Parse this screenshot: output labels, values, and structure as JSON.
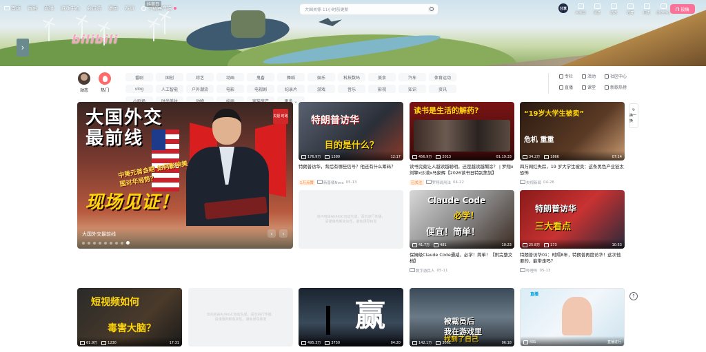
{
  "topnav": {
    "items": [
      "首页",
      "番剧",
      "直播",
      "游戏中心",
      "会员购",
      "漫画",
      "赛事"
    ],
    "bubble": "抖音日",
    "download": "下载客户端"
  },
  "logo": "bilibili",
  "search": {
    "placeholder": "大国关係 11小时前更新"
  },
  "user": {
    "avatar_text": "分享"
  },
  "rightnav": [
    "大会员",
    "消息",
    "动态",
    "收藏",
    "历史",
    "创作中心"
  ],
  "upload": "投稿",
  "channels": {
    "dynamic": "动态",
    "hot": "热门",
    "chips": [
      "番剧",
      "国创",
      "综艺",
      "动画",
      "鬼畜",
      "舞蹈",
      "娱乐",
      "科技数码",
      "美食",
      "汽车",
      "体育运动",
      "vlog",
      "人工智能",
      "户外潮流",
      "电影",
      "电视剧",
      "纪录片",
      "游戏",
      "音乐",
      "影视",
      "知识",
      "资讯",
      "小剧场",
      "时尚美妆",
      "动物",
      "绘画",
      "家装房产",
      "更多 ⌄"
    ],
    "extras": [
      "专栏",
      "活动",
      "社区中心",
      "直播",
      "课堂",
      "新歌热榜"
    ]
  },
  "featured": {
    "title_line1": "大国外交",
    "title_line2": "最前线",
    "subtitle": "中美元首会晤 如何影响美国对华局势？",
    "slogan": "现场见证！",
    "badge": "央视 时政",
    "caption": "大国外交最前线"
  },
  "side_buttons": {
    "refresh": "换一换"
  },
  "cards": [
    {
      "thumb_text": "特朗普访华",
      "thumb_text2": "目的是什么？",
      "views": "176.9万",
      "danmaku": "1380",
      "duration": "12:17",
      "title": "特朗普访华，背后有哪些信号？他还有什么筹码？",
      "tag": "1万点赞",
      "owner": "新晋楠Nora",
      "date": "05-13"
    },
    {
      "thumb_text": "读书是生活的解药?",
      "views": "456.9万",
      "danmaku": "2013",
      "duration": "01:19:33",
      "title": "读书究竟让人越读越聪明，还是越读越糊涂？ | 罗翔x刘擎x沙漠x马家辉【2026读书日特别策划】",
      "tag": "已关注",
      "owner": "罗翔说刑法",
      "date": "04-22"
    },
    {
      "thumb_text": "“19岁大学生被卖”",
      "thumb_text2": "危机 重重",
      "views": "34.2万",
      "danmaku": "1866",
      "duration": "07:14",
      "title": "四万网红失踪，19 岁大学生被卖：这条黑色产业链太恐怖",
      "owner": "央视新闻",
      "date": "04-26"
    },
    {
      "placeholder": "该内容由AI/AIGC自动生成，请勿进行传播，请谨慎判断真实性，避免误导转发"
    },
    {
      "thumb_text": "Claude Code",
      "thumb_text2": "必学！",
      "thumb_text3": "便宜！简单！",
      "views": "41.7万",
      "danmaku": "481",
      "duration": "10:23",
      "title": "保姆级Claude Code通咸，必学！简单！【附完整文档】",
      "owner": "数字游民人",
      "date": "05-11"
    },
    {
      "thumb_text": "特朗普访华",
      "thumb_text2": "三大看点",
      "views": "25.8万",
      "danmaku": "173",
      "duration": "10:53",
      "title": "特朗普访华01：时隔8年，特朗普再度访华！这次他要的，能带走吗？",
      "owner": "哔哩哔",
      "date": "05-13"
    },
    {
      "thumb_text": "短视频如何",
      "thumb_text2": "毒害大脑？",
      "views": "61.9万",
      "danmaku": "1230",
      "duration": "17:31",
      "title": "",
      "owner": "",
      "date": ""
    },
    {
      "placeholder": "该内容由AI/AIGC自动生成，请勿进行传播，请谨慎判断真实性，避免误导转发"
    },
    {
      "thumb_text": "赢",
      "views": "495.3万",
      "danmaku": "3750",
      "duration": "04:20",
      "title": "",
      "owner": "",
      "date": ""
    },
    {
      "thumb_text": "被裁员后",
      "thumb_text2": "我在游戏里",
      "thumb_text3": "找到了自己",
      "views": "142.1万",
      "danmaku": "3061",
      "duration": "06:18",
      "title": "",
      "owner": "",
      "date": ""
    },
    {
      "thumb_text": "直播",
      "views": "431",
      "duration": "直播进行",
      "title": "",
      "owner": "",
      "date": ""
    }
  ]
}
